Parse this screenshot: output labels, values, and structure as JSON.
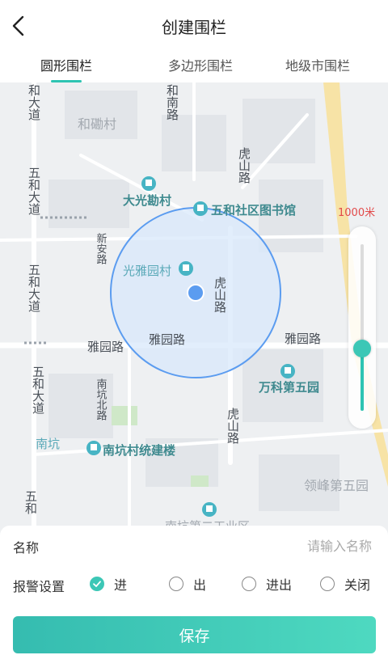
{
  "header": {
    "title": "创建围栏"
  },
  "tabs": [
    {
      "label": "圆形围栏",
      "active": true
    },
    {
      "label": "多边形围栏",
      "active": false
    },
    {
      "label": "地级市围栏",
      "active": false
    }
  ],
  "map": {
    "distance_label": "1000米",
    "places": {
      "daguang": "大光勘村",
      "library": "五和社区图书馆",
      "guangyayuan": "光雅园村",
      "wanke": "万科第五园",
      "nankengcun": "南坑村统建楼",
      "hedicun": "和磡村",
      "lingfeng": "领峰第五园",
      "nankeng": "南坑",
      "cutoff": "南坑第二工业区"
    },
    "roads": {
      "wuhe_top": "和大道",
      "wuhe_mid": "五和大道",
      "wuhe_low": "五和大道",
      "wuhe_lower": "五和大道",
      "wuhe_bottom": "五和",
      "henan": "和南路",
      "hushan_top": "虎山路",
      "hushan_mid": "虎山路",
      "hushan_low": "虎山路",
      "xinan": "新安路",
      "yayuan_left": "雅园路",
      "yayuan_mid": "雅园路",
      "yayuan_right": "雅园路",
      "nankengbei": "南坑北路"
    },
    "colors": {
      "fence": "#5b9cf0",
      "fence_fill": "#d8e8fb",
      "center": "#5b9cf0",
      "poi": "#47b4c4",
      "accent": "#3cc7b6"
    }
  },
  "form": {
    "name_label": "名称",
    "name_placeholder": "请输入名称",
    "name_value": "",
    "alarm_label": "报警设置",
    "alarm_options": [
      {
        "label": "进",
        "selected": true
      },
      {
        "label": "出",
        "selected": false
      },
      {
        "label": "进出",
        "selected": false
      },
      {
        "label": "关闭",
        "selected": false
      }
    ],
    "save_label": "保存"
  }
}
